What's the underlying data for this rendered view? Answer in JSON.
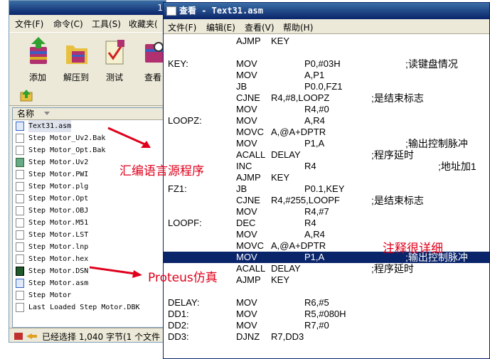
{
  "left": {
    "title": "1",
    "menu": [
      "文件(F)",
      "命令(C)",
      "工具(S)",
      "收藏夹("
    ],
    "toolbar": [
      "添加",
      "解压到",
      "测试",
      "查看"
    ],
    "file_header": "名称",
    "files": [
      "Text31.asm",
      "Step Motor_Uv2.Bak",
      "Step Motor_Opt.Bak",
      "Step Motor.Uv2",
      "Step Motor.PWI",
      "Step Motor.plg",
      "Step Motor.Opt",
      "Step Motor.OBJ",
      "Step Motor.M51",
      "Step Motor.LST",
      "Step Motor.lnp",
      "Step Motor.hex",
      "Step Motor.DSN",
      "Step Motor.asm",
      "Step Motor",
      "Last Loaded Step Motor.DBK"
    ],
    "status": "已经选择 1,040 字节(1 个文件"
  },
  "right": {
    "title": "查看 - Text31.asm",
    "menu": [
      "文件(F)",
      "编辑(E)",
      "查看(V)",
      "帮助(H)"
    ],
    "code": [
      {
        "label": "",
        "op": "AJMP",
        "arg": "KEY",
        "cmt": ""
      },
      {
        "label": "",
        "op": "",
        "arg": "",
        "cmt": ""
      },
      {
        "label": "KEY:",
        "op": "MOV",
        "arg": "P0,#03H",
        "cmt": ";读键盘情况"
      },
      {
        "label": "",
        "op": "MOV",
        "arg": "A,P1",
        "cmt": ""
      },
      {
        "label": "",
        "op": "JB",
        "arg": "P0.0,FZ1",
        "cmt": ""
      },
      {
        "label": "",
        "op": "CJNE",
        "arg": "R4,#8,LOOPZ",
        "cmt": ";是结束标志"
      },
      {
        "label": "",
        "op": "MOV",
        "arg": "R4,#0",
        "cmt": ""
      },
      {
        "label": "LOOPZ:",
        "op": "MOV",
        "arg": "A,R4",
        "cmt": ""
      },
      {
        "label": "",
        "op": "MOVC",
        "arg": "A,@A+DPTR",
        "cmt": ""
      },
      {
        "label": "",
        "op": "MOV",
        "arg": "P1,A",
        "cmt": ";输出控制脉冲"
      },
      {
        "label": "",
        "op": "ACALL",
        "arg": "DELAY",
        "cmt": ";程序延时"
      },
      {
        "label": "",
        "op": "INC",
        "arg": "R4",
        "cmt": ";地址加1"
      },
      {
        "label": "",
        "op": "AJMP",
        "arg": "KEY",
        "cmt": ""
      },
      {
        "label": "FZ1:",
        "op": "JB",
        "arg": "P0.1,KEY",
        "cmt": ""
      },
      {
        "label": "",
        "op": "CJNE",
        "arg": "R4,#255,LOOPF",
        "cmt": ";是结束标志"
      },
      {
        "label": "",
        "op": "MOV",
        "arg": "R4,#7",
        "cmt": ""
      },
      {
        "label": "LOOPF:",
        "op": "DEC",
        "arg": "R4",
        "cmt": ""
      },
      {
        "label": "",
        "op": "MOV",
        "arg": "A,R4",
        "cmt": ""
      },
      {
        "label": "",
        "op": "MOVC",
        "arg": "A,@A+DPTR",
        "cmt": ""
      },
      {
        "label": "",
        "op": "MOV",
        "arg": "P1,A",
        "cmt": ";输出控制脉冲"
      },
      {
        "label": "",
        "op": "ACALL",
        "arg": "DELAY",
        "cmt": ";程序延时"
      },
      {
        "label": "",
        "op": "AJMP",
        "arg": "KEY",
        "cmt": ""
      },
      {
        "label": "",
        "op": "",
        "arg": "",
        "cmt": ""
      },
      {
        "label": "DELAY:",
        "op": "MOV",
        "arg": "R6,#5",
        "cmt": ""
      },
      {
        "label": "DD1:",
        "op": "MOV",
        "arg": "R5,#080H",
        "cmt": ""
      },
      {
        "label": "DD2:",
        "op": "MOV",
        "arg": "R7,#0",
        "cmt": ""
      },
      {
        "label": "DD3:",
        "op": "DJNZ",
        "arg": "R7,DD3",
        "cmt": ""
      }
    ],
    "highlighted_line": 19
  },
  "annotations": {
    "source": "汇编语言源程序",
    "proteus": "Proteus仿真",
    "comment": "注释很详细",
    "color": "#e0001b"
  }
}
